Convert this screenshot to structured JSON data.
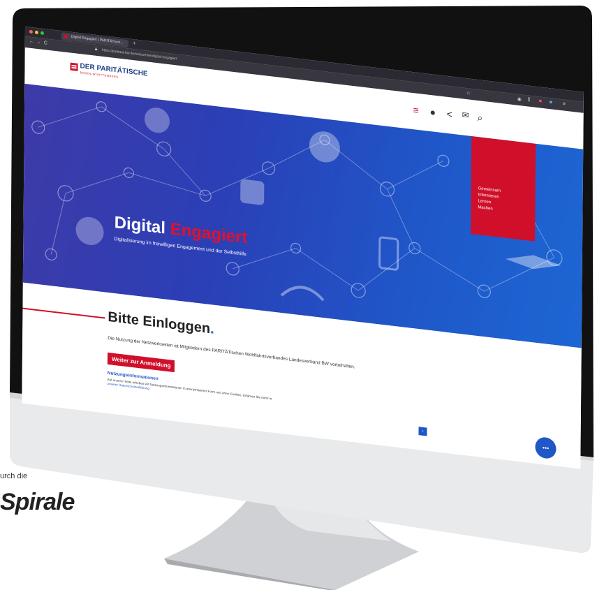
{
  "browser": {
    "tab_title": "Digital Engagiert | PARITÄTisch...",
    "url": "https://paritaet-bw.de/netzwerke/digital-engagiert",
    "new_tab": "+",
    "nav_back": "←",
    "nav_forward": "→",
    "nav_reload": "C"
  },
  "site": {
    "logo_text": "DER PARITÄTISCHE",
    "logo_sub": "BADEN-WÜRTTEMBERG",
    "hero_title_1": "Digital",
    "hero_title_2": "Engagiert",
    "hero_subtitle": "Digitalisierung im freiwilligen Engagement und der Selbsthilfe",
    "menu": [
      "Gemeinsam",
      "Informieren",
      "Lernen",
      "Machen"
    ],
    "heading": "Bitte Einloggen",
    "heading_dot": ".",
    "paragraph": "Die Nutzung der Netzwerkseiten ist Mitgliedern des PARITÄTischen Wohlfahrtsverbandes Landesverband BW vorbehalten.",
    "button": "Weiter zur Anmeldung",
    "notice_heading": "Nutzungsinformationen",
    "notice_text_1": "Auf unserer Seite erheben wir Nutzungsinformationen in anonymisierter Form und ohne Cookies. Erfahren Sie mehr in",
    "notice_link": "unserer Datenschutzerklärung.",
    "scroll_button": "›"
  },
  "caption": {
    "small": "urch die",
    "big": "Spirale"
  },
  "colors": {
    "brand_red": "#d0102b",
    "brand_blue": "#1f3f86",
    "hero_blue": "#1f57c9"
  }
}
